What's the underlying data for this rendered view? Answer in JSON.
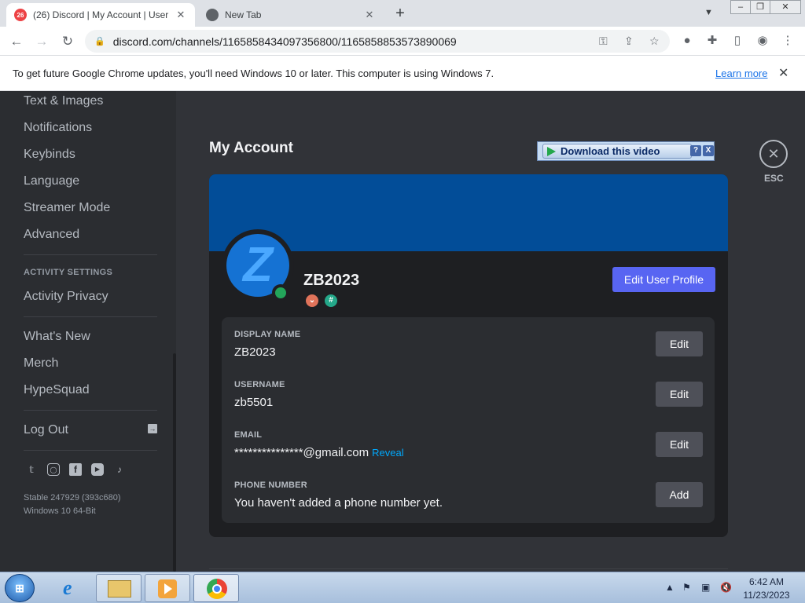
{
  "browser": {
    "tabs": [
      {
        "title": "(26) Discord | My Account | User",
        "favicon_badge": "26",
        "active": true
      },
      {
        "title": "New Tab",
        "active": false
      }
    ],
    "url": "discord.com/channels/1165858434097356800/1165858853573890069",
    "infobar": {
      "message": "To get future Google Chrome updates, you'll need Windows 10 or later. This computer is using Windows 7.",
      "link": "Learn more"
    }
  },
  "sidebar": {
    "items_top": [
      "Text & Images",
      "Notifications",
      "Keybinds",
      "Language",
      "Streamer Mode",
      "Advanced"
    ],
    "activity_header": "ACTIVITY SETTINGS",
    "activity_items": [
      "Activity Privacy"
    ],
    "misc_items": [
      "What's New",
      "Merch",
      "HypeSquad"
    ],
    "logout": "Log Out",
    "social_icons": [
      "twitter-icon",
      "instagram-icon",
      "facebook-icon",
      "youtube-icon",
      "tiktok-icon"
    ],
    "version_line1": "Stable 247929 (393c680)",
    "version_line2": "Windows 10 64-Bit"
  },
  "main": {
    "title": "My Account",
    "download_overlay": {
      "label": "Download this video",
      "help": "?",
      "close": "X"
    },
    "esc_label": "ESC",
    "profile": {
      "username": "ZB2023",
      "edit_profile_label": "Edit User Profile",
      "banner_color": "#024d98"
    },
    "fields": [
      {
        "label": "DISPLAY NAME",
        "value": "ZB2023",
        "button": "Edit"
      },
      {
        "label": "USERNAME",
        "value": "zb5501",
        "button": "Edit"
      },
      {
        "label": "EMAIL",
        "value": "***************@gmail.com",
        "extra": "Reveal",
        "button": "Edit"
      },
      {
        "label": "PHONE NUMBER",
        "value": "You haven't added a phone number yet.",
        "button": "Add"
      }
    ]
  },
  "taskbar": {
    "clock_time": "6:42 AM",
    "clock_date": "11/23/2023"
  },
  "colors": {
    "discord_blurple": "#5865f2",
    "discord_bg": "#313338",
    "sidebar_bg": "#2b2d31",
    "online_green": "#23a55a",
    "reveal_link": "#00a8fc"
  }
}
